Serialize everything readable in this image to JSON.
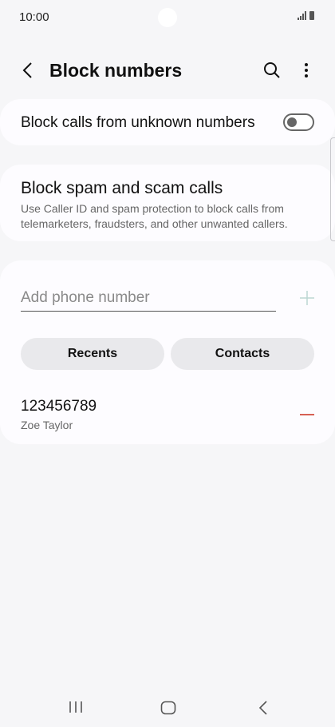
{
  "status_bar": {
    "time": "10:00",
    "icons": [
      "signal-icon",
      "battery-icon"
    ]
  },
  "app_bar": {
    "title": "Block numbers",
    "icons": [
      "back-arrow-icon",
      "search-icon",
      "more-vertical-icon"
    ]
  },
  "block_unknown": {
    "label": "Block calls from unknown numbers",
    "toggle_on": false
  },
  "spam": {
    "title": "Block spam and scam calls",
    "description": "Use Caller ID and spam protection to block calls from telemarketers, fraudsters, and other unwanted callers."
  },
  "add_number": {
    "placeholder": "Add phone number",
    "value": "",
    "add_icon": "plus-icon",
    "buttons": {
      "recents": "Recents",
      "contacts": "Contacts"
    }
  },
  "blocked_list": [
    {
      "number": "123456789",
      "name": "Zoe Taylor",
      "remove_icon": "minus-icon"
    }
  ],
  "nav_bar": {
    "icons": [
      "recent-apps-icon",
      "home-icon",
      "back-icon"
    ]
  },
  "colors": {
    "background": "#f6f6f8",
    "card": "#fdfcff",
    "remove_accent": "#d04a3c",
    "pill": "#e9e9ec"
  }
}
